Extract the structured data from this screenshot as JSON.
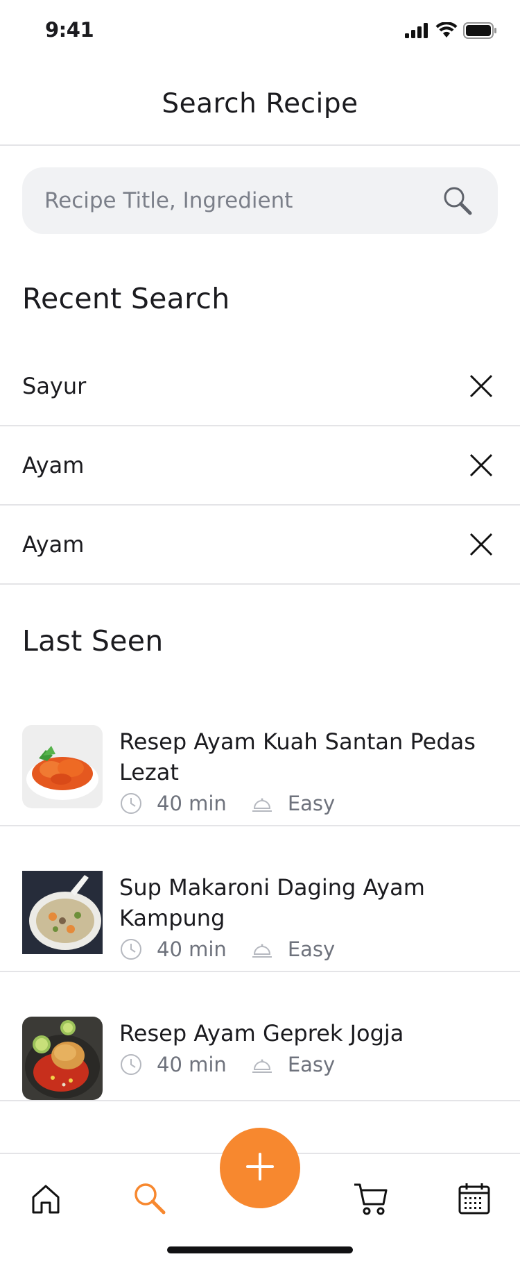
{
  "status_bar": {
    "time": "9:41"
  },
  "header": {
    "title": "Search Recipe"
  },
  "search": {
    "placeholder": "Recipe Title, Ingredient",
    "value": ""
  },
  "recent": {
    "title": "Recent Search",
    "items": [
      {
        "label": "Sayur"
      },
      {
        "label": "Ayam"
      },
      {
        "label": "Ayam"
      }
    ]
  },
  "last_seen": {
    "title": "Last Seen",
    "items": [
      {
        "title": "Resep Ayam Kuah Santan Pedas Lezat",
        "time": "40 min",
        "difficulty": "Easy"
      },
      {
        "title": "Sup Makaroni Daging Ayam Kampung",
        "time": "40 min",
        "difficulty": "Easy"
      },
      {
        "title": "Resep Ayam Geprek Jogja",
        "time": "40 min",
        "difficulty": "Easy"
      }
    ]
  },
  "nav": {
    "items": [
      "home-icon",
      "search-icon",
      "add-icon",
      "cart-icon",
      "calendar-icon"
    ],
    "active": "search-icon"
  },
  "colors": {
    "accent": "#f7882f",
    "text": "#1b1b1f",
    "muted": "#6e727c",
    "divider": "#e4e4e7",
    "search_bg": "#f1f2f4"
  }
}
